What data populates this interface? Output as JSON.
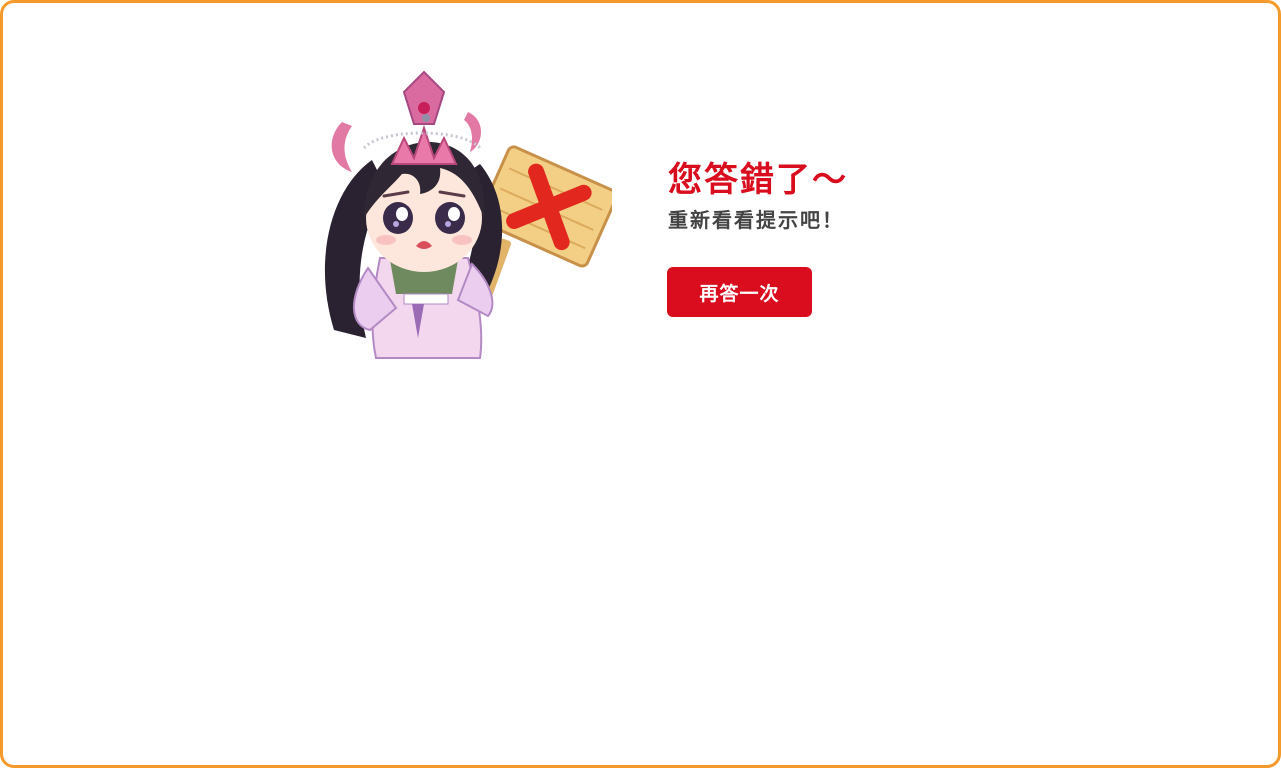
{
  "result": {
    "title": "您答錯了～",
    "subtitle": "重新看看提示吧！",
    "retry_label": "再答一次"
  },
  "mascot": {
    "description_icon": "cartoon-girl-holding-x-sign-icon"
  },
  "colors": {
    "frame_border": "#f39a2b",
    "accent_red": "#d90d1e",
    "text_dark": "#444444"
  }
}
